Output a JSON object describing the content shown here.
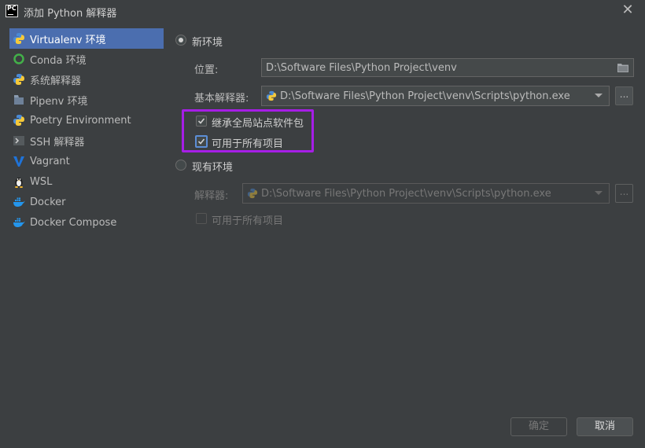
{
  "window": {
    "title": "添加 Python 解释器",
    "app_icon_text": "PC"
  },
  "sidebar": {
    "items": [
      {
        "label": "Virtualenv 环境",
        "icon": "python-icon",
        "selected": true
      },
      {
        "label": "Conda 环境",
        "icon": "conda-icon"
      },
      {
        "label": "系统解释器",
        "icon": "python-icon"
      },
      {
        "label": "Pipenv 环境",
        "icon": "pipenv-icon"
      },
      {
        "label": "Poetry Environment",
        "icon": "poetry-icon"
      },
      {
        "label": "SSH 解释器",
        "icon": "ssh-terminal-icon"
      },
      {
        "label": "Vagrant",
        "icon": "vagrant-icon"
      },
      {
        "label": "WSL",
        "icon": "linux-penguin-icon"
      },
      {
        "label": "Docker",
        "icon": "docker-icon"
      },
      {
        "label": "Docker Compose",
        "icon": "docker-icon"
      }
    ]
  },
  "new_env": {
    "radio_label": "新环境",
    "location_label": "位置:",
    "location_value": "D:\\Software Files\\Python Project\\venv",
    "base_interpreter_label": "基本解释器:",
    "base_interpreter_value": "D:\\Software Files\\Python Project\\venv\\Scripts\\python.exe",
    "inherit_label": "继承全局站点软件包",
    "available_all_label": "可用于所有项目",
    "dots_label": "..."
  },
  "existing_env": {
    "radio_label": "现有环境",
    "interpreter_label": "解释器:",
    "interpreter_value": "D:\\Software Files\\Python Project\\venv\\Scripts\\python.exe",
    "available_all_label": "可用于所有项目",
    "dots_label": "..."
  },
  "buttons": {
    "ok_label": "确定",
    "cancel_label": "取消"
  },
  "colors": {
    "background": "#3c3f41",
    "selection": "#4b6eaf",
    "highlight_box": "#a61ee6",
    "focus": "#5c8ed6"
  }
}
